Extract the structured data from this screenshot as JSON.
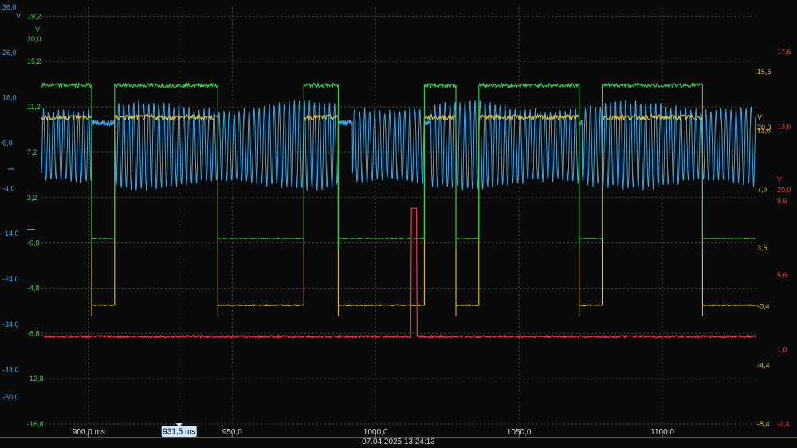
{
  "chart_data": {
    "type": "line",
    "x_unit_label": "ms",
    "xlim": [
      883.5,
      1132.5
    ],
    "x_ticks": [
      {
        "value": 900,
        "label": "900,0 ms"
      },
      {
        "value": 950,
        "label": "950,0"
      },
      {
        "value": 1000,
        "label": "1000,0"
      },
      {
        "value": 1050,
        "label": "1050,0"
      },
      {
        "value": 1100,
        "label": "1100,0"
      }
    ],
    "timestamp": "07.04.2025 13:24:13",
    "cursor": {
      "x": 931.5,
      "label": "931,5 ms",
      "color": "#cfe6ff"
    },
    "axes": [
      {
        "id": "blue",
        "side": "left",
        "color": "#3aa6e8",
        "unit": "V",
        "ylim": [
          -56,
          36
        ],
        "ticks": [
          "36,0",
          "26,0",
          "16,0",
          "6,0",
          "-4,0",
          "-14,0",
          "-24,0",
          "-34,0",
          "-44,0",
          "-50,0"
        ],
        "tick_values": [
          36,
          26,
          16,
          6,
          -4,
          -14,
          -24,
          -34,
          -44,
          -50
        ]
      },
      {
        "id": "green",
        "side": "left",
        "color": "#35d04a",
        "unit": "V",
        "ylim": [
          -16.8,
          20.0
        ],
        "ticks": [
          "20,0",
          "19,2",
          "15,2",
          "11,2",
          "7,2",
          "3,2",
          "-0,8",
          "-4,8",
          "-8,8",
          "-12,8",
          "-16,8"
        ],
        "tick_values": [
          20.0,
          19.2,
          15.2,
          11.2,
          7.2,
          3.2,
          -0.8,
          -4.8,
          -8.8,
          -12.8,
          -16.8
        ]
      },
      {
        "id": "yellow",
        "side": "right",
        "color": "#e0c03a",
        "unit": "V",
        "ylim": [
          -8.4,
          20.0
        ],
        "ticks": [
          "20,0",
          "15,6",
          "11,6",
          "7,6",
          "3,6",
          "-0,4",
          "-4,4",
          "-8,4"
        ],
        "tick_values": [
          20.0,
          15.6,
          11.6,
          7.6,
          3.6,
          -0.4,
          -4.4,
          -8.4
        ]
      },
      {
        "id": "red",
        "side": "right",
        "color": "#e83a4a",
        "unit": "V",
        "ylim": [
          -2.4,
          20.0
        ],
        "ticks": [
          "20,0",
          "17,6",
          "13,6",
          "9,6",
          "5,6",
          "1,6",
          "-2,4"
        ],
        "tick_values": [
          20.0,
          17.6,
          13.6,
          9.6,
          5.6,
          1.6,
          -2.4
        ]
      }
    ],
    "series": [
      {
        "axis": "green",
        "color": "#35d04a",
        "high": 13.1,
        "low": -0.4,
        "edges": [
          [
            883.5,
            "H"
          ],
          [
            901,
            "L"
          ],
          [
            909,
            "H"
          ],
          [
            945,
            "L"
          ],
          [
            975,
            "H"
          ],
          [
            987,
            "L"
          ],
          [
            1017,
            "H"
          ],
          [
            1028,
            "L"
          ],
          [
            1036,
            "H"
          ],
          [
            1071,
            "L"
          ],
          [
            1079,
            "H"
          ],
          [
            1114,
            "L"
          ]
        ]
      },
      {
        "axis": "yellow",
        "color": "#e0c03a",
        "high": 12.5,
        "low": -0.3,
        "edges": [
          [
            883.5,
            "H"
          ],
          [
            901,
            "L"
          ],
          [
            909,
            "H"
          ],
          [
            945,
            "L"
          ],
          [
            975,
            "H"
          ],
          [
            987,
            "L"
          ],
          [
            1017,
            "H"
          ],
          [
            1028,
            "L"
          ],
          [
            1036,
            "H"
          ],
          [
            1071,
            "L"
          ],
          [
            1079,
            "H"
          ],
          [
            1114,
            "L"
          ]
        ]
      },
      {
        "axis": "red",
        "color": "#e83a4a",
        "base": 2.3,
        "pulse": {
          "start": 1012.5,
          "end": 1014.5,
          "value": 9.2
        }
      },
      {
        "axis": "blue",
        "color": "#3aa6e8",
        "center": 5.5,
        "amp": 8.5,
        "period": 1.75,
        "gaps": [
          [
            901,
            909
          ],
          [
            987,
            992
          ],
          [
            1017,
            1019
          ],
          [
            1071,
            1072
          ]
        ]
      }
    ]
  }
}
